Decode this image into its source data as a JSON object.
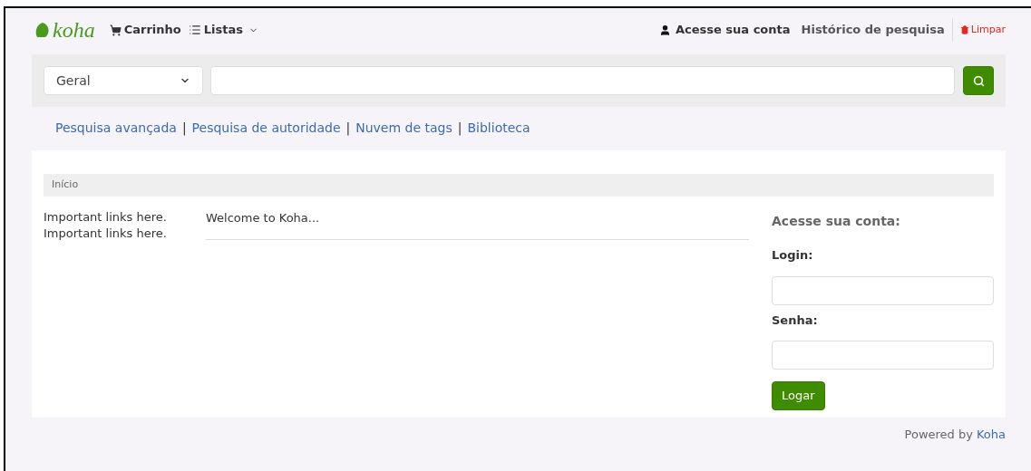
{
  "navbar": {
    "logo": "koha",
    "cart": "Carrinho",
    "lists": "Listas",
    "account": "Acesse sua conta",
    "history": "Histórico de pesquisa",
    "clear": "Limpar"
  },
  "search": {
    "scope": "Geral"
  },
  "links": [
    "Pesquisa avançada",
    "Pesquisa de autoridade",
    "Nuvem de tags",
    "Biblioteca"
  ],
  "link_separators": [
    "|",
    "|",
    "|"
  ],
  "breadcrumb": "Início",
  "side_links": [
    "Important links here.",
    "Important links here."
  ],
  "welcome": "Welcome to Koha...",
  "login": {
    "title": "Acesse sua conta:",
    "login_label": "Login:",
    "password_label": "Senha:",
    "button": "Logar"
  },
  "footer": {
    "text": "Powered by",
    "link": "Koha"
  }
}
